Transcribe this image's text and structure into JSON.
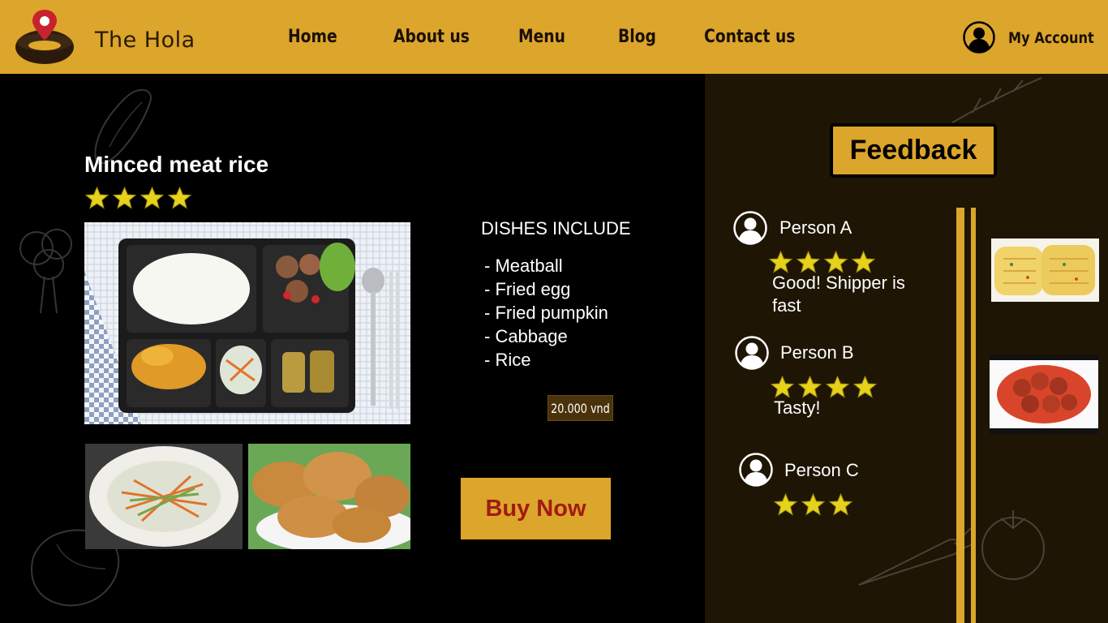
{
  "header": {
    "brand": "The Hola",
    "nav": [
      "Home",
      "About us",
      "Menu",
      "Blog",
      "Contact us"
    ],
    "account_label": "My Account"
  },
  "dish": {
    "title": "Minced meat rice",
    "rating": 4,
    "dishes_heading": "DISHES INCLUDE",
    "items": [
      "- Meatball",
      "- Fried egg",
      "- Fried pumpkin",
      "- Cabbage",
      "- Rice"
    ],
    "price": "20.000 vnd",
    "buy_label": "Buy Now"
  },
  "feedback": {
    "title": "Feedback",
    "reviews": [
      {
        "name": "Person A",
        "rating": 4,
        "comment": "Good! Shipper is fast"
      },
      {
        "name": "Person B",
        "rating": 4,
        "comment": "Tasty!"
      },
      {
        "name": "Person C",
        "rating": 3,
        "comment": ""
      }
    ]
  },
  "colors": {
    "header_bg": "#dca52b",
    "panel_bg": "#1f1504",
    "buy_text": "#a11b12",
    "star": "#e6d21a"
  }
}
